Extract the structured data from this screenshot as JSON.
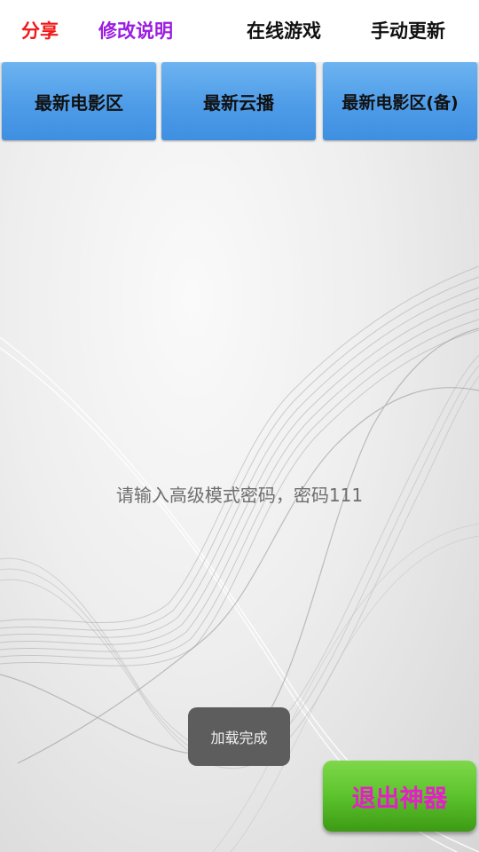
{
  "colors": {
    "share_link": "#f01818",
    "notes_link": "#9b1ce0",
    "plain_link": "#111111",
    "exit_label": "#e61ec8"
  },
  "top_links": {
    "share": "分享",
    "notes": "修改说明",
    "games": "在线游戏",
    "update": "手动更新"
  },
  "tiles": {
    "latest_movies": "最新电影区",
    "latest_cloud": "最新云播",
    "latest_movies_backup": "最新电影区(备)"
  },
  "prompt": "请输入高级模式密码，密码111",
  "toast": "加载完成",
  "exit_button": "退出神器"
}
